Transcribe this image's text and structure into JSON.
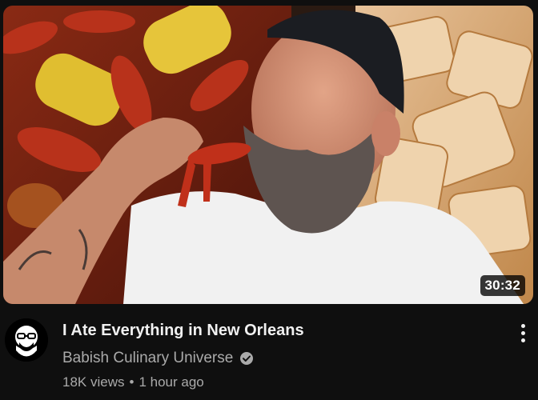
{
  "video": {
    "title": "I Ate Everything in New Orleans",
    "channel": "Babish Culinary Universe",
    "verified": true,
    "views": "18K views",
    "separator": "•",
    "age": "1 hour ago",
    "duration": "30:32"
  },
  "thumbnail": {
    "description_icon": "video-thumbnail",
    "colors": {
      "background_left": "#7a2614",
      "background_right": "#d9a86a",
      "shirt": "#f2f2f2",
      "cap": "#1b1d22"
    }
  },
  "avatar": {
    "icon": "channel-avatar-icon",
    "bg": "#000000"
  },
  "menu": {
    "icon": "more-vert-icon"
  },
  "colors": {
    "page_bg": "#0f0f0f",
    "title": "#f1f1f1",
    "secondary_text": "#aaaaaa"
  }
}
